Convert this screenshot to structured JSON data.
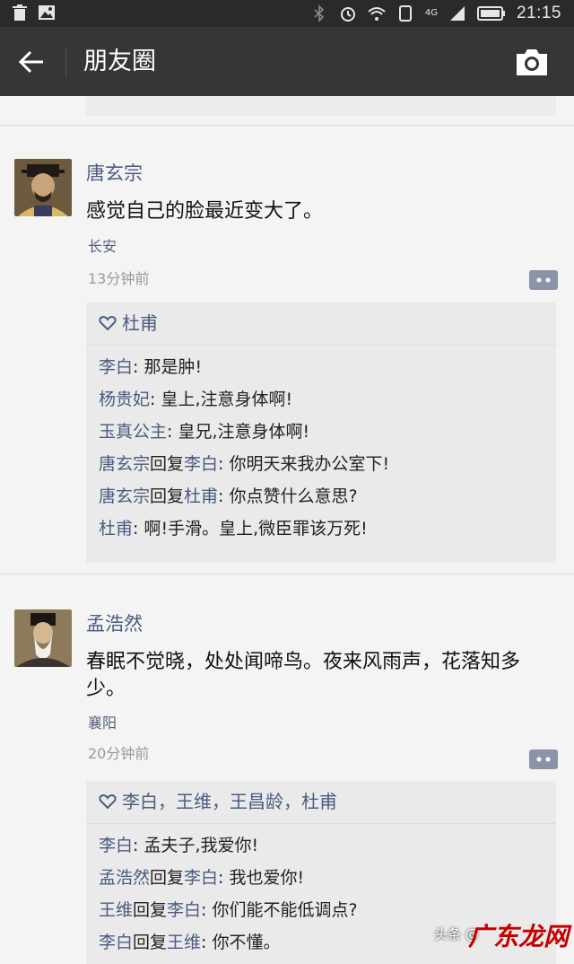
{
  "status_bar": {
    "time": "21:15",
    "network_label": "4G",
    "icons_left": [
      "trash-icon",
      "image-icon"
    ],
    "icons_right": [
      "bluetooth-icon",
      "alarm-icon",
      "wifi-icon",
      "sim-icon",
      "signal-icon",
      "battery-icon"
    ]
  },
  "header": {
    "title": "朋友圈",
    "back_icon": "arrow-left-icon",
    "camera_icon": "camera-icon"
  },
  "posts": [
    {
      "author": "唐玄宗",
      "text": "感觉自己的脸最近变大了。",
      "location": "长安",
      "time": "13分钟前",
      "likes": "杜甫",
      "comments": [
        {
          "name": "李白",
          "text": ": 那是肿!"
        },
        {
          "name": "杨贵妃",
          "text": ": 皇上,注意身体啊!"
        },
        {
          "name": "玉真公主",
          "text": ": 皇兄,注意身体啊!"
        },
        {
          "name": "唐玄宗",
          "reply_word": "回复",
          "reply_to": "李白",
          "text": ": 你明天来我办公室下!"
        },
        {
          "name": "唐玄宗",
          "reply_word": "回复",
          "reply_to": "杜甫",
          "text": ": 你点赞什么意思?"
        },
        {
          "name": "杜甫",
          "text": ": 啊!手滑。皇上,微臣罪该万死!"
        }
      ]
    },
    {
      "author": "孟浩然",
      "text": "春眠不觉晓，处处闻啼鸟。夜来风雨声，花落知多少。",
      "location": "襄阳",
      "time": "20分钟前",
      "likes": "李白，王维，王昌龄，杜甫",
      "comments": [
        {
          "name": "李白",
          "text": ": 孟夫子,我爱你!"
        },
        {
          "name": "孟浩然",
          "reply_word": "回复",
          "reply_to": "李白",
          "text": ": 我也爱你!"
        },
        {
          "name": "王维",
          "reply_word": "回复",
          "reply_to": "李白",
          "text": ": 你们能不能低调点?"
        },
        {
          "name": "李白",
          "reply_word": "回复",
          "reply_to": "王维",
          "text": ": 你不懂。"
        }
      ]
    }
  ],
  "watermark": {
    "source": "头条 @",
    "brand": "广东龙网"
  }
}
